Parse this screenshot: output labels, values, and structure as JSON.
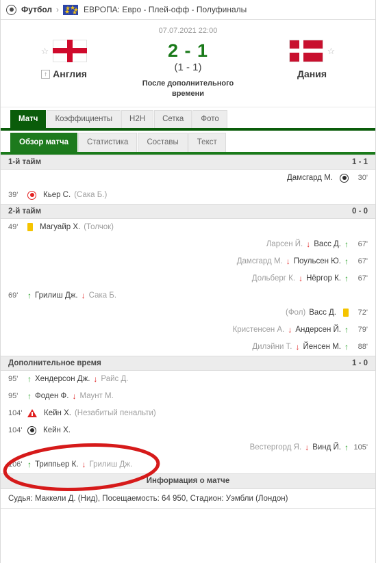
{
  "breadcrumb": {
    "sport": "Футбол",
    "separator": "›",
    "competition": "ЕВРОПА: Евро - Плей-офф - Полуфиналы"
  },
  "match": {
    "kickoff": "07.07.2021 22:00",
    "score": "2 - 1",
    "halftime_score": "(1 - 1)",
    "note": "После дополнительного времени",
    "home": {
      "name": "Англия",
      "rank_badge": "↑"
    },
    "away": {
      "name": "Дания",
      "rank_badge": ""
    },
    "star": "☆"
  },
  "tabs_main": [
    {
      "label": "Матч",
      "active": true
    },
    {
      "label": "Коэффициенты",
      "active": false
    },
    {
      "label": "H2H",
      "active": false
    },
    {
      "label": "Сетка",
      "active": false
    },
    {
      "label": "Фото",
      "active": false
    }
  ],
  "tabs_sub": [
    {
      "label": "Обзор матча",
      "active": true
    },
    {
      "label": "Статистика",
      "active": false
    },
    {
      "label": "Составы",
      "active": false
    },
    {
      "label": "Текст",
      "active": false
    }
  ],
  "periods": [
    {
      "title": "1-й тайм",
      "score": "1 - 1",
      "events": [
        {
          "side": "away",
          "minute": "30'",
          "icon": "goal-icon",
          "player": "Дамсгард М.",
          "detail": ""
        },
        {
          "side": "home",
          "minute": "39'",
          "icon": "own-goal-icon",
          "player": "Кьер С.",
          "detail": "(Сака Б.)"
        }
      ]
    },
    {
      "title": "2-й тайм",
      "score": "0 - 0",
      "events": [
        {
          "side": "home",
          "minute": "49'",
          "icon": "yellow-card-icon",
          "player": "Магуайр Х.",
          "detail": "(Толчок)"
        },
        {
          "side": "away",
          "minute": "67'",
          "icon": "substitution-icon",
          "player_out": "Ларсен Й.",
          "player_in": "Васс Д."
        },
        {
          "side": "away",
          "minute": "67'",
          "icon": "substitution-icon",
          "player_out": "Дамсгард М.",
          "player_in": "Поульсен Ю."
        },
        {
          "side": "away",
          "minute": "67'",
          "icon": "substitution-icon",
          "player_out": "Дольберг К.",
          "player_in": "Нёргор К."
        },
        {
          "side": "home",
          "minute": "69'",
          "icon": "substitution-icon",
          "player_in": "Грилиш Дж.",
          "player_out": "Сака Б."
        },
        {
          "side": "away",
          "minute": "72'",
          "icon": "yellow-card-icon",
          "player": "Васс Д.",
          "detail": "(Фол)"
        },
        {
          "side": "away",
          "minute": "79'",
          "icon": "substitution-icon",
          "player_out": "Кристенсен А.",
          "player_in": "Андерсен Й."
        },
        {
          "side": "away",
          "minute": "88'",
          "icon": "substitution-icon",
          "player_out": "Дилэйни Т.",
          "player_in": "Йенсен М."
        }
      ]
    },
    {
      "title": "Дополнительное время",
      "score": "1 - 0",
      "events": [
        {
          "side": "home",
          "minute": "95'",
          "icon": "substitution-icon",
          "player_in": "Хендерсон Дж.",
          "player_out": "Райс Д."
        },
        {
          "side": "home",
          "minute": "95'",
          "icon": "substitution-icon",
          "player_in": "Фоден Ф.",
          "player_out": "Маунт М."
        },
        {
          "side": "home",
          "minute": "104'",
          "icon": "missed-penalty-icon",
          "player": "Кейн Х.",
          "detail": "(Незабитый пенальти)"
        },
        {
          "side": "home",
          "minute": "104'",
          "icon": "goal-icon",
          "player": "Кейн Х.",
          "detail": ""
        },
        {
          "side": "away",
          "minute": "105'",
          "icon": "substitution-icon",
          "player_out": "Вестергорд Я.",
          "player_in": "Винд Й."
        },
        {
          "side": "home",
          "minute": "106'",
          "icon": "substitution-icon",
          "player_in": "Триппьер К.",
          "player_out": "Грилиш Дж."
        }
      ]
    }
  ],
  "match_info": {
    "title": "Информация о матче",
    "details": "Судья: Маккели Д. (Нид), Посещаемость: 64 950, Стадион: Уэмбли (Лондон)"
  },
  "annotation": {
    "shape": "red-ellipse-highlight",
    "color": "#d61a1a"
  }
}
